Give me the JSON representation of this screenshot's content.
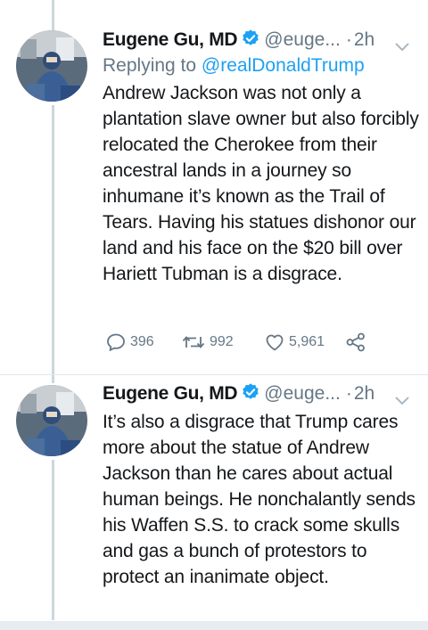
{
  "tweets": [
    {
      "author_name": "Eugene Gu, MD",
      "handle": "@euge...",
      "separator": "·",
      "time": "2h",
      "replying_label": "Replying to",
      "replying_to": "@realDonaldTrump",
      "text": "Andrew Jackson was not only a plantation slave owner but also forcibly relocated the Cherokee from their ancestral lands in a journey so inhumane it’s known as the Trail of Tears. Having his statues dishonor our land and his face on the $20 bill over Hariett Tubman is a disgrace.",
      "replies": "396",
      "retweets": "992",
      "likes": "5,961"
    },
    {
      "author_name": "Eugene Gu, MD",
      "handle": "@euge...",
      "separator": "·",
      "time": "2h",
      "text": "It’s also a disgrace that Trump cares more about the statue of Andrew Jackson than he cares about actual human beings. He nonchalantly sends his Waffen S.S. to crack some skulls and gas a bunch of protestors to protect an inanimate object."
    }
  ],
  "icons": {
    "verified": "verified-badge-icon",
    "caret": "chevron-down-icon",
    "reply": "reply-icon",
    "retweet": "retweet-icon",
    "like": "heart-icon",
    "share": "share-icon"
  },
  "colors": {
    "text": "#14171a",
    "secondary": "#657786",
    "link": "#1da1f2",
    "verified": "#1da1f2",
    "thread_line": "#ccd6dd"
  }
}
